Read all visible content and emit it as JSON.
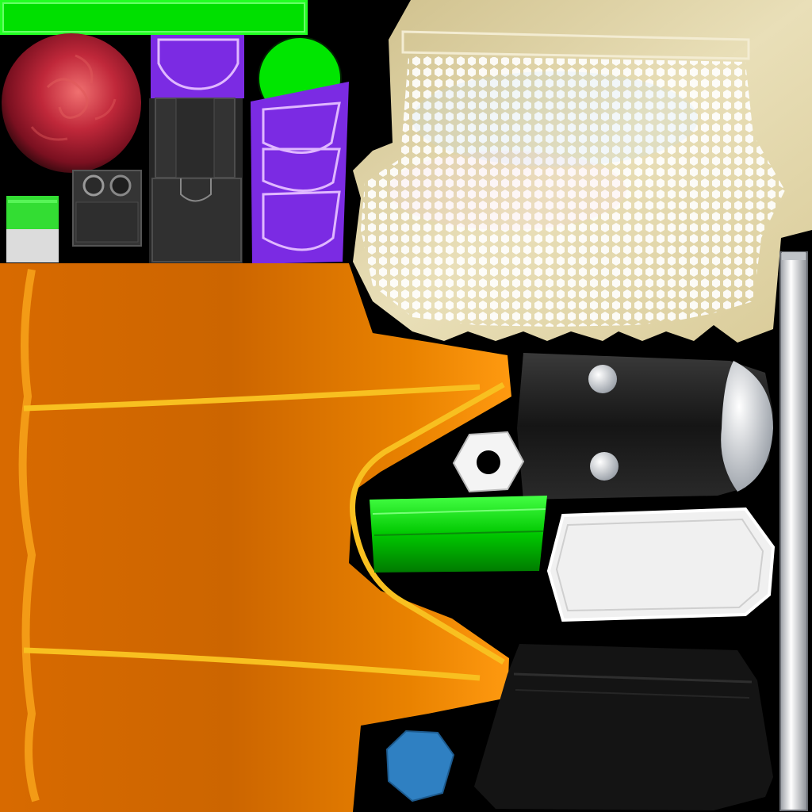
{
  "texture_atlas": {
    "background_color": "#000000",
    "islands": [
      {
        "name": "green-strip",
        "color": "#00ff00"
      },
      {
        "name": "red-swirl-sphere",
        "color": "#c0283a"
      },
      {
        "name": "purple-collar-top",
        "color": "#7a2be0"
      },
      {
        "name": "dark-vest-panel",
        "color": "#2b2b2b"
      },
      {
        "name": "green-disc",
        "color": "#00e600"
      },
      {
        "name": "purple-scale-strip",
        "color": "#7a2be0"
      },
      {
        "name": "camera-box",
        "color": "#3a3a3a"
      },
      {
        "name": "green-white-swatch",
        "color": "#22dd22"
      },
      {
        "name": "sequined-lace-skirt",
        "color": "#e8dcb0"
      },
      {
        "name": "silver-pole",
        "color": "#d9dce0"
      },
      {
        "name": "orange-cape",
        "color": "#e07800"
      },
      {
        "name": "black-capsule",
        "color": "#1c1c1c"
      },
      {
        "name": "white-hex-nut",
        "color": "#f2f2f2"
      },
      {
        "name": "green-band",
        "color": "#11cc11"
      },
      {
        "name": "white-pill",
        "color": "#eeeeee"
      },
      {
        "name": "black-skirt",
        "color": "#121212"
      },
      {
        "name": "blue-blob",
        "color": "#2f7fc0"
      }
    ]
  }
}
